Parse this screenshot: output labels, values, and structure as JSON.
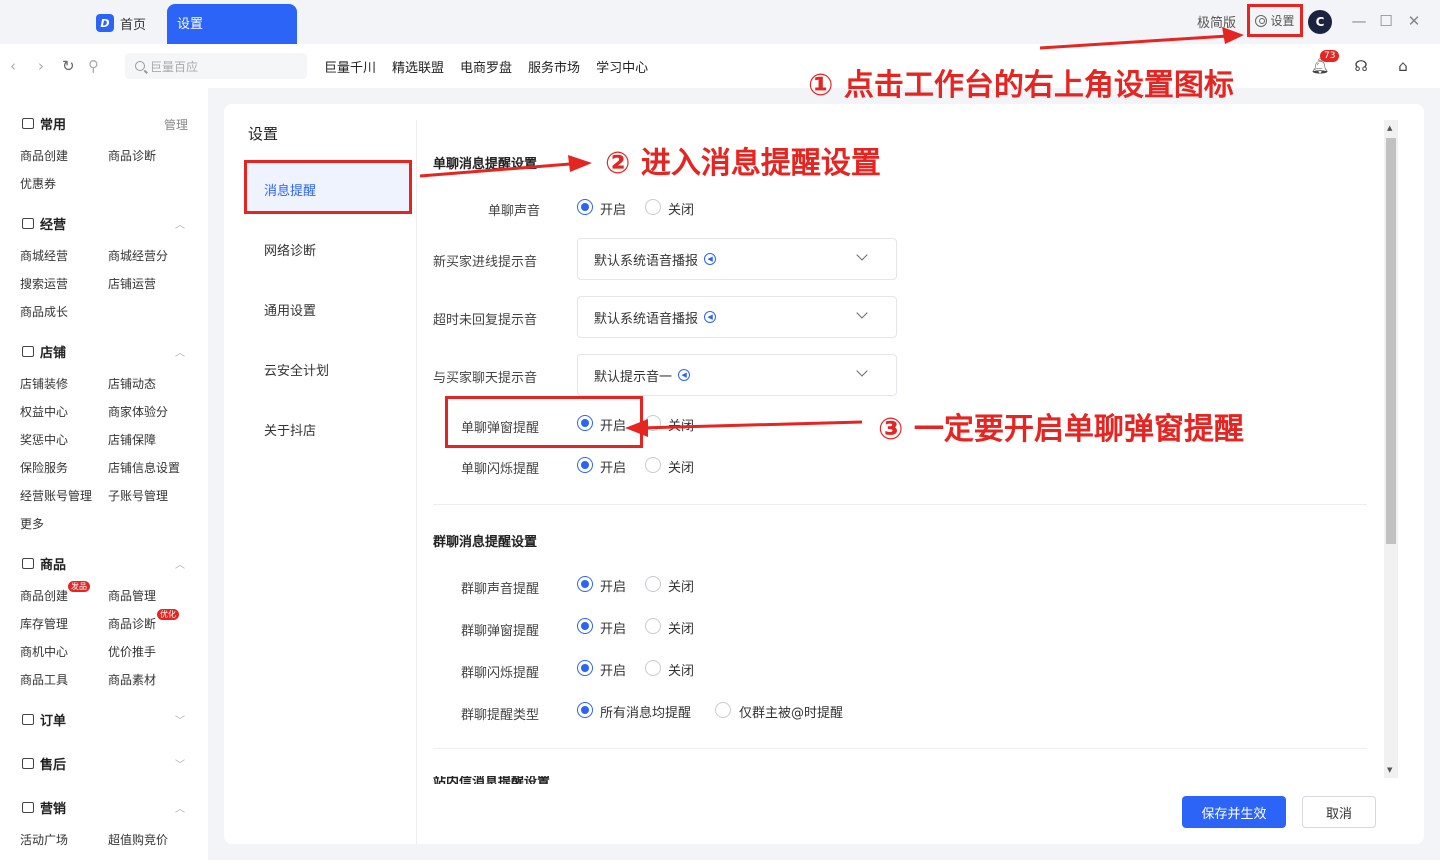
{
  "titlebar": {
    "tab_home": "首页",
    "tab_settings": "设置",
    "simple_mode": "极简版",
    "settings": "设置",
    "avatar_letter": "C"
  },
  "navbar": {
    "search_placeholder": "巨量百应",
    "links": [
      "巨量千川",
      "精选联盟",
      "电商罗盘",
      "服务市场",
      "学习中心"
    ],
    "notification_count": "73"
  },
  "sidebar": {
    "common": {
      "title": "常用",
      "manage": "管理",
      "items": [
        "商品创建",
        "商品诊断",
        "优惠券"
      ]
    },
    "operate": {
      "title": "经营",
      "items": [
        "商城经营",
        "商城经营分",
        "搜索运营",
        "店铺运营",
        "商品成长"
      ]
    },
    "store": {
      "title": "店铺",
      "items": [
        "店铺装修",
        "店铺动态",
        "权益中心",
        "商家体验分",
        "奖惩中心",
        "店铺保障",
        "保险服务",
        "店铺信息设置",
        "经营账号管理",
        "子账号管理",
        "更多"
      ]
    },
    "goods": {
      "title": "商品",
      "items": [
        "商品创建",
        "商品管理",
        "库存管理",
        "商品诊断",
        "商机中心",
        "优价推手",
        "商品工具",
        "商品素材"
      ],
      "badge_new": "发品",
      "badge_opt": "优化"
    },
    "orders": {
      "title": "订单"
    },
    "aftersale": {
      "title": "售后"
    },
    "marketing": {
      "title": "营销",
      "items": [
        "活动广场",
        "超值购竞价"
      ]
    }
  },
  "settings": {
    "title": "设置",
    "menu": [
      "消息提醒",
      "网络诊断",
      "通用设置",
      "云安全计划",
      "关于抖店"
    ],
    "single_group_title": "单聊消息提醒设置",
    "group_group_title": "群聊消息提醒设置",
    "cut_title": "站内信消息提醒设置",
    "on": "开启",
    "off": "关闭",
    "single_sound": "单聊声音",
    "new_buyer_sound": "新买家进线提示音",
    "new_buyer_value": "默认系统语音播报",
    "timeout_sound": "超时未回复提示音",
    "timeout_value": "默认系统语音播报",
    "chat_sound": "与买家聊天提示音",
    "chat_value": "默认提示音一",
    "single_popup": "单聊弹窗提醒",
    "single_flash": "单聊闪烁提醒",
    "group_sound": "群聊声音提醒",
    "group_popup": "群聊弹窗提醒",
    "group_flash": "群聊闪烁提醒",
    "group_type": "群聊提醒类型",
    "group_type_all": "所有消息均提醒",
    "group_type_at": "仅群主被@时提醒",
    "save": "保存并生效",
    "cancel": "取消"
  },
  "annotations": {
    "step1": "① 点击工作台的右上角设置图标",
    "step2": "② 进入消息提醒设置",
    "step3": "③ 一定要开启单聊弹窗提醒"
  },
  "colors": {
    "accent": "#2b64f6",
    "annotation": "#e52521"
  }
}
